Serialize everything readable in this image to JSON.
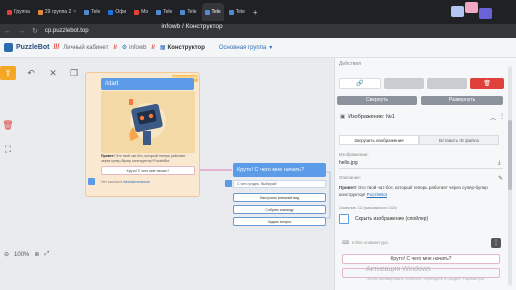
{
  "browser": {
    "tabs": [
      {
        "label": "Группа"
      },
      {
        "label": "29 группа 2"
      },
      {
        "label": "Tele"
      },
      {
        "label": "Офи"
      },
      {
        "label": "Мо"
      },
      {
        "label": "Tele"
      },
      {
        "label": "Tele"
      },
      {
        "label": "Tele"
      },
      {
        "label": "Tele"
      }
    ],
    "new_tab": "+",
    "address": "cp.puzzlebot.top",
    "page_title": "infowb / Конструктор"
  },
  "header": {
    "logo": "PuzzleBot",
    "logo_sep": "///",
    "crumbs": [
      "Личный кабинет",
      "infowb",
      "Конструктор",
      "Основная группа"
    ]
  },
  "canvas": {
    "start_card": {
      "badge": "ВЫЧИСЛЕНИЯ",
      "title": "/start",
      "text_bold": "Привет!",
      "text": " Это твой чат-бот, который теперь работает через супер-булер конструктор! PuzzleBot",
      "button": "Круто! С чего мне начать?",
      "footer_prefix": "Нет ссылок в",
      "footer_link": "Автоматическое"
    },
    "node2": {
      "title": "Круто! С чего мне начать?",
      "text": "С чего угодно. Выбирай!",
      "buttons": [
        "Настроить внешний вид",
        "Собрать команду",
        "Задать вопрос"
      ]
    },
    "zoom_label": "100%"
  },
  "panel": {
    "title": "Действия",
    "collapse_label": "Свернуть",
    "expand_label": "Развернуть",
    "section": "Изображение: №1",
    "subtabs": [
      "Загрузить изображение",
      "Вставить ID файла"
    ],
    "image_label": "Изображение:",
    "image_value": "hello.jpg",
    "desc_label": "Описание:",
    "desc_bold": "Привет!",
    "desc_text": " Это твой чат-бот, который теперь работает через супер-булер конструктор!",
    "desc_link": "PuzzleBot",
    "symbols_label": "Символов: 112 (максимально 1024)",
    "spoiler_label": "Скрыть изображение (спойлер)",
    "keyboard_title": "Inline клавиатура",
    "keyboard_button": "Круто! С чего мне начать?",
    "watermark": "Активация Windows",
    "watermark_sub": "Чтобы активировать Windows, перейдите в раздел \"Параметры\"."
  }
}
